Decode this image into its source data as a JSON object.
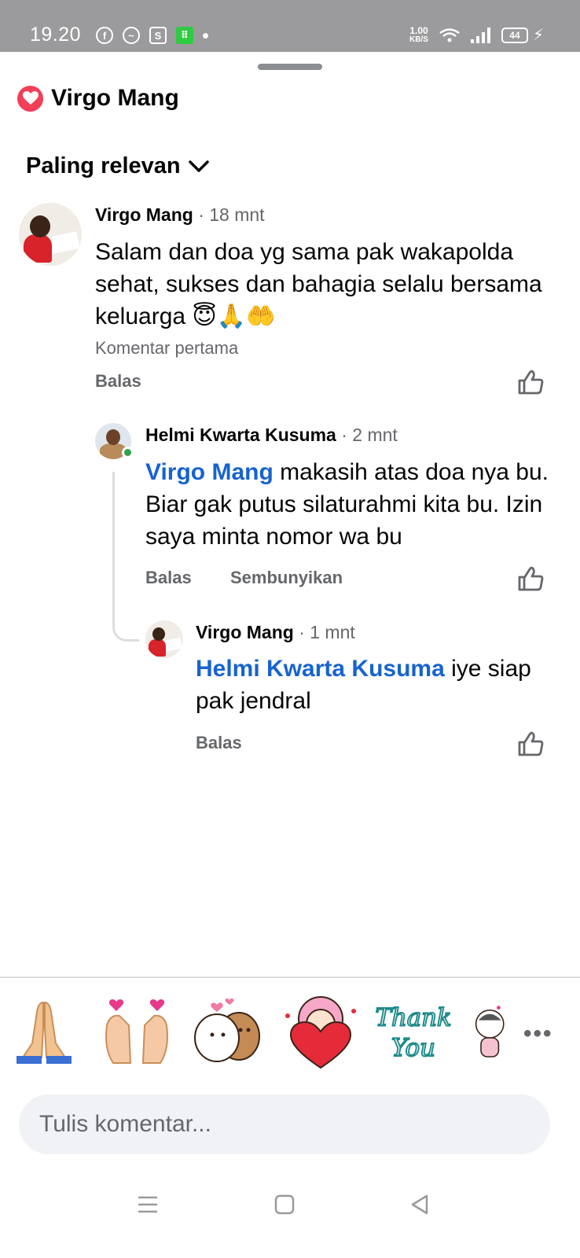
{
  "status_bar": {
    "time": "19.20",
    "speed_value": "1.00",
    "speed_unit": "KB/S",
    "battery": "44"
  },
  "header": {
    "title": "Virgo Mang"
  },
  "sort": {
    "label": "Paling relevan"
  },
  "comments": [
    {
      "author": "Virgo Mang",
      "time": "· 18 mnt",
      "text": "Salam dan doa yg sama pak wakapolda sehat, sukses dan bahagia selalu bersama keluarga 😇🙏🤲",
      "badge": "Komentar pertama",
      "reply_label": "Balas"
    },
    {
      "author": "Helmi Kwarta Kusuma",
      "time": "· 2 mnt",
      "mention": "Virgo Mang",
      "text": " makasih atas doa nya bu. Biar gak putus silaturahmi kita bu. Izin saya minta nomor wa bu",
      "reply_label": "Balas",
      "hide_label": "Sembunyikan"
    },
    {
      "author": "Virgo Mang",
      "time": "· 1 mnt",
      "mention": "Helmi Kwarta Kusuma",
      "text": " iye siap pak jendral",
      "reply_label": "Balas"
    }
  ],
  "stickers": [
    "praying-hands",
    "finger-hearts",
    "hugging-bears",
    "girl-with-heart",
    "thank-you",
    "girl-sticker-partial"
  ],
  "composer": {
    "placeholder": "Tulis komentar..."
  },
  "colors": {
    "mention": "#1763cf",
    "heart_badge": "#f33e58",
    "status_bar": "#9b9b9d",
    "composer_bg": "#f0f2f5"
  }
}
